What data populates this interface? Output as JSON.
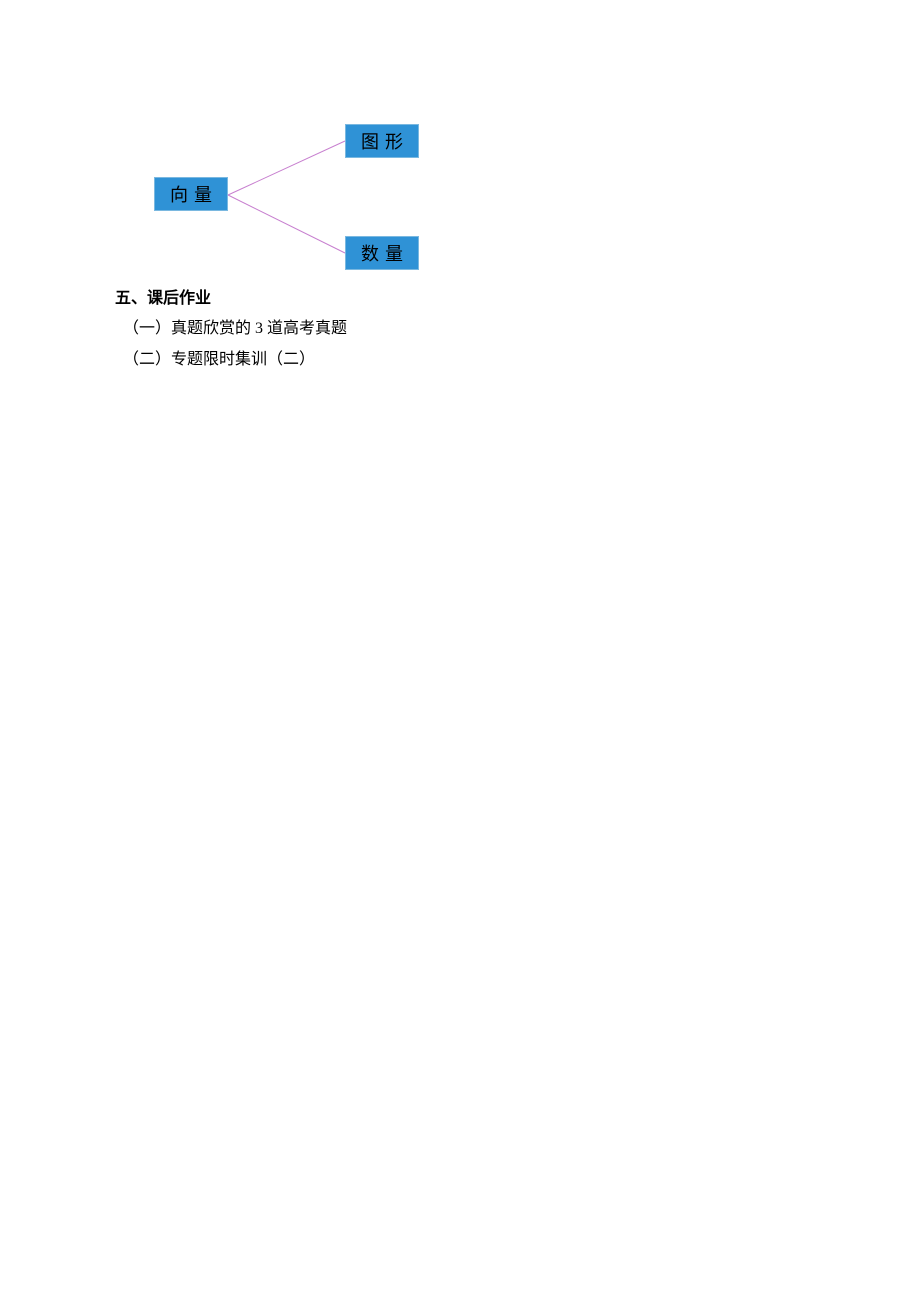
{
  "diagram": {
    "root": "向量",
    "branch_top": "图形",
    "branch_bottom": "数量",
    "line_color": "#c77fcf"
  },
  "section": {
    "heading": "五、课后作业",
    "items": [
      "（一）真题欣赏的 3 道高考真题",
      "（二）专题限时集训（二）"
    ]
  }
}
